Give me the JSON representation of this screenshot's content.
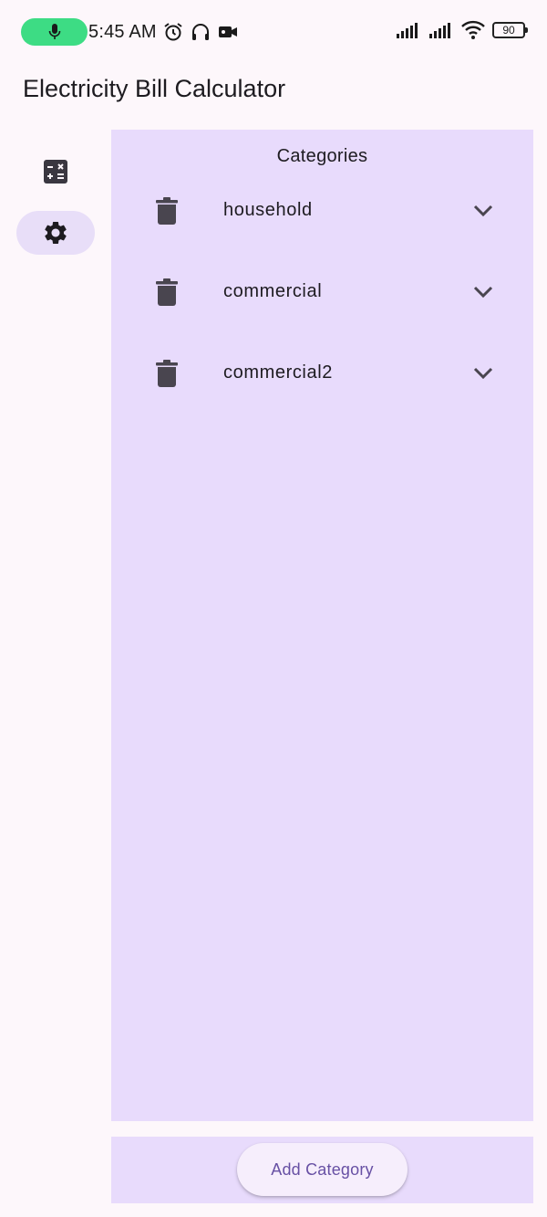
{
  "status_bar": {
    "time": "5:45 AM",
    "battery": "90",
    "icons": [
      "mic-icon",
      "alarm-icon",
      "headset-icon",
      "video-camera-icon",
      "signal-icon",
      "signal-icon",
      "wifi-icon",
      "battery-icon"
    ]
  },
  "app_bar": {
    "title": "Electricity Bill Calculator"
  },
  "nav_rail": {
    "items": [
      {
        "icon": "calculator-icon",
        "selected": false
      },
      {
        "icon": "gear-icon",
        "selected": true
      }
    ]
  },
  "categories": {
    "title": "Categories",
    "items": [
      {
        "name": "household"
      },
      {
        "name": "commercial"
      },
      {
        "name": "commercial2"
      }
    ]
  },
  "bottom": {
    "add_label": "Add Category"
  },
  "colors": {
    "background": "#fdf7fb",
    "panel": "#e8dbfc",
    "selected_nav": "#e8def8",
    "accent": "#6750a4",
    "mic_pill": "#3ddc84"
  }
}
